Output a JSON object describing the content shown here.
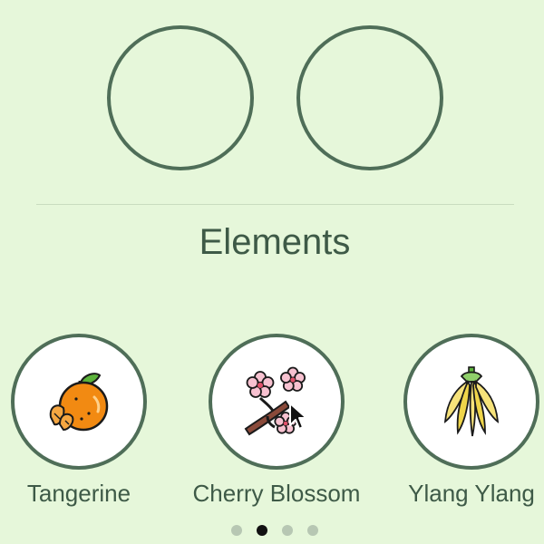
{
  "slots": {
    "slot_1_label": "",
    "slot_2_label": ""
  },
  "section": {
    "title": "Elements"
  },
  "elements": [
    {
      "label": "Tangerine",
      "icon": "tangerine-icon"
    },
    {
      "label": "Cherry Blossom",
      "icon": "cherry-blossom-icon"
    },
    {
      "label": "Ylang Ylang",
      "icon": "ylang-ylang-icon"
    }
  ],
  "pager": {
    "count": 4,
    "active_index": 1
  },
  "colors": {
    "background": "#e6f7da",
    "ring": "#4f6e58",
    "text": "#3e5a47",
    "active_dot": "#111111",
    "inactive_dot": "#b7c7b3"
  }
}
